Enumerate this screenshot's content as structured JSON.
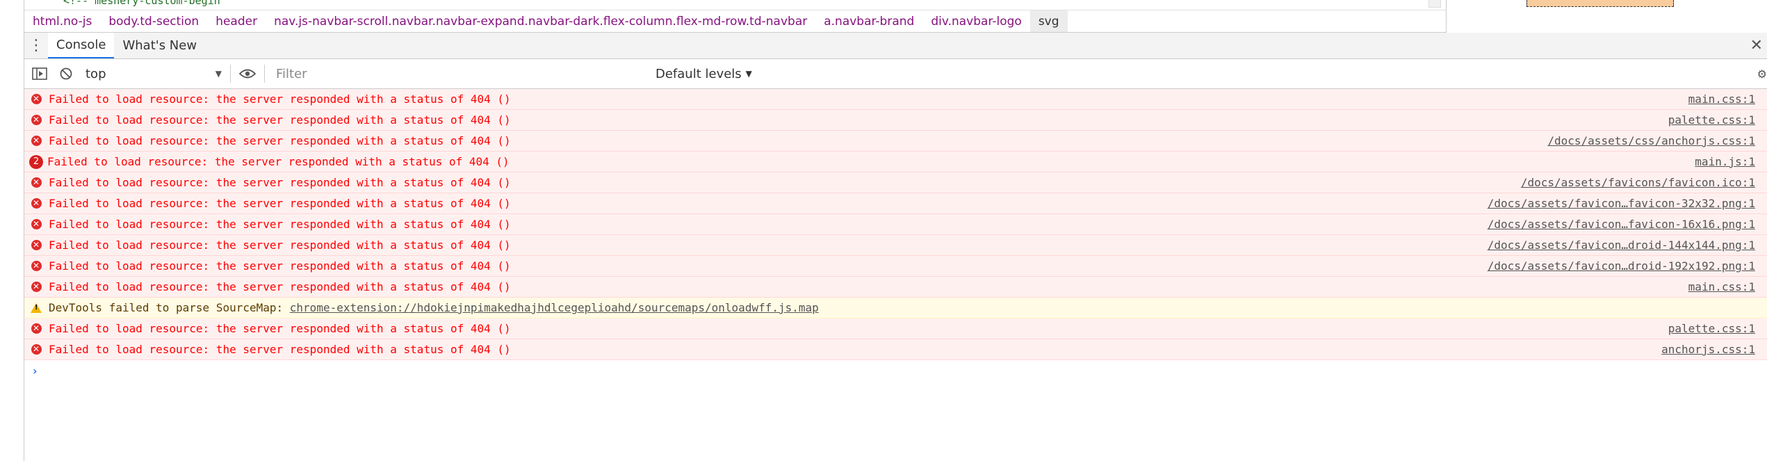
{
  "elements": {
    "code_line": "<!-- meshery-custom-begin"
  },
  "breadcrumb": [
    "html.no-js",
    "body.td-section",
    "header",
    "nav.js-navbar-scroll.navbar.navbar-expand.navbar-dark.flex-column.flex-md-row.td-navbar",
    "a.navbar-brand",
    "div.navbar-logo",
    "svg"
  ],
  "drawer": {
    "tabs": [
      "Console",
      "What's New"
    ],
    "active_tab": "Console"
  },
  "toolbar": {
    "context": "top",
    "filter_placeholder": "Filter",
    "levels": "Default levels"
  },
  "messages": [
    {
      "type": "error",
      "text": "Failed to load resource: the server responded with a status of 404 ()",
      "source": "main.css:1"
    },
    {
      "type": "error",
      "text": "Failed to load resource: the server responded with a status of 404 ()",
      "source": "palette.css:1"
    },
    {
      "type": "error",
      "text": "Failed to load resource: the server responded with a status of 404 ()",
      "source": "/docs/assets/css/anchorjs.css:1"
    },
    {
      "type": "error",
      "count": "2",
      "text": "Failed to load resource: the server responded with a status of 404 ()",
      "source": "main.js:1"
    },
    {
      "type": "error",
      "text": "Failed to load resource: the server responded with a status of 404 ()",
      "source": "/docs/assets/favicons/favicon.ico:1"
    },
    {
      "type": "error",
      "text": "Failed to load resource: the server responded with a status of 404 ()",
      "source": "/docs/assets/favicon…favicon-32x32.png:1"
    },
    {
      "type": "error",
      "text": "Failed to load resource: the server responded with a status of 404 ()",
      "source": "/docs/assets/favicon…favicon-16x16.png:1"
    },
    {
      "type": "error",
      "text": "Failed to load resource: the server responded with a status of 404 ()",
      "source": "/docs/assets/favicon…droid-144x144.png:1"
    },
    {
      "type": "error",
      "text": "Failed to load resource: the server responded with a status of 404 ()",
      "source": "/docs/assets/favicon…droid-192x192.png:1"
    },
    {
      "type": "error",
      "text": "Failed to load resource: the server responded with a status of 404 ()",
      "source": "main.css:1"
    },
    {
      "type": "warning",
      "text": "DevTools failed to parse SourceMap: ",
      "link": "chrome-extension://hdokiejnpimakedhajhdlcegeplioahd/sourcemaps/onloadwff.js.map"
    },
    {
      "type": "error",
      "text": "Failed to load resource: the server responded with a status of 404 ()",
      "source": "palette.css:1"
    },
    {
      "type": "error",
      "text": "Failed to load resource: the server responded with a status of 404 ()",
      "source": "anchorjs.css:1"
    }
  ],
  "colors": {
    "error_text": "#ff0000",
    "error_bg": "#fff0f0",
    "warning_bg": "#fffbe5",
    "accent": "#1a73e8"
  }
}
